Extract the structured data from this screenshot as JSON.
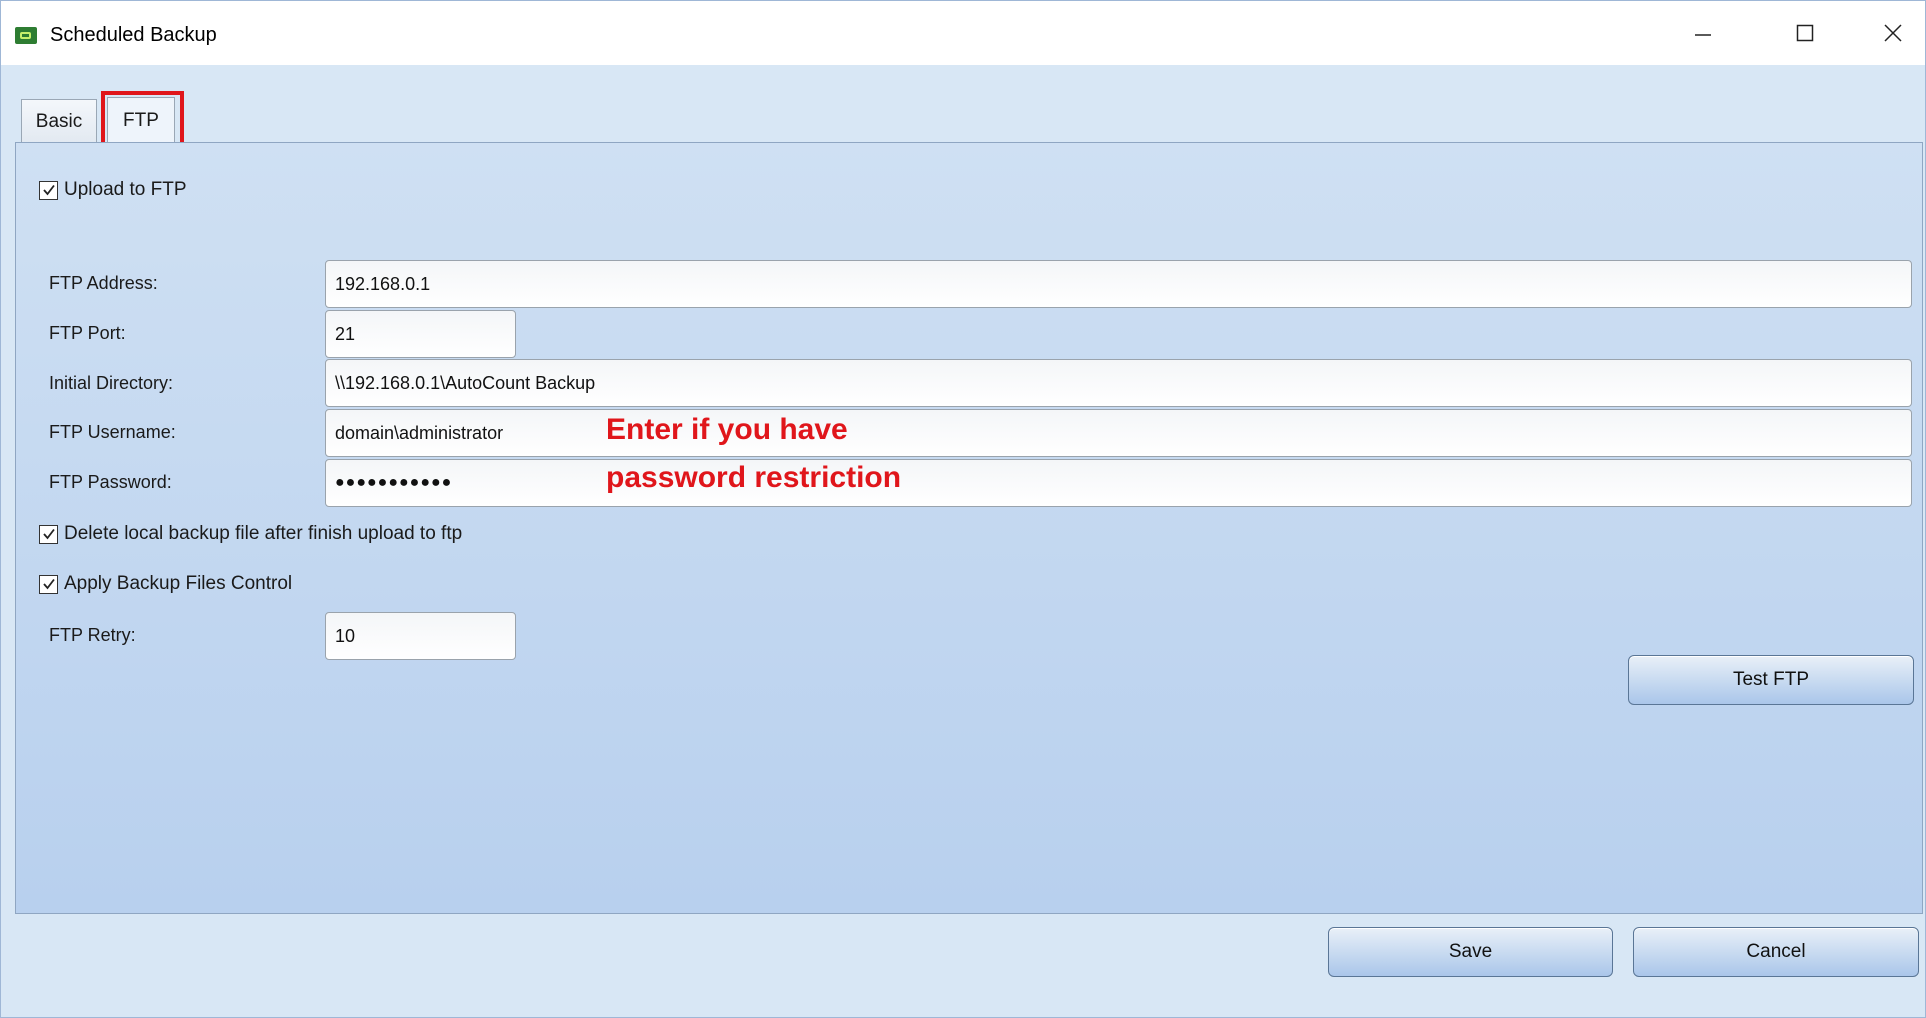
{
  "window": {
    "title": "Scheduled Backup",
    "minimize_glyph": "—",
    "close_glyph": "✕"
  },
  "tabs": [
    {
      "label": "Basic"
    },
    {
      "label": "FTP"
    }
  ],
  "ftp": {
    "upload_checkbox": {
      "label": "Upload to FTP",
      "checked": true
    },
    "fields": {
      "address": {
        "label": "FTP Address:",
        "value": "192.168.0.1"
      },
      "port": {
        "label": "FTP Port:",
        "value": "21"
      },
      "initial_directory": {
        "label": "Initial Directory:",
        "value": "\\\\192.168.0.1\\AutoCount Backup"
      },
      "username": {
        "label": "FTP Username:",
        "value": "domain\\administrator"
      },
      "password": {
        "label": "FTP Password:",
        "value": "●●●●●●●●●●●"
      },
      "retry": {
        "label": "FTP Retry:",
        "value": "10"
      }
    },
    "delete_local_checkbox": {
      "label": "Delete local backup file after finish upload to ftp",
      "checked": true
    },
    "apply_control_checkbox": {
      "label": "Apply Backup Files Control",
      "checked": true
    },
    "test_button": "Test FTP"
  },
  "annotation": {
    "line1": "Enter if you have",
    "line2": "password restriction",
    "color": "#e0161b"
  },
  "footer": {
    "save_label": "Save",
    "cancel_label": "Cancel"
  }
}
